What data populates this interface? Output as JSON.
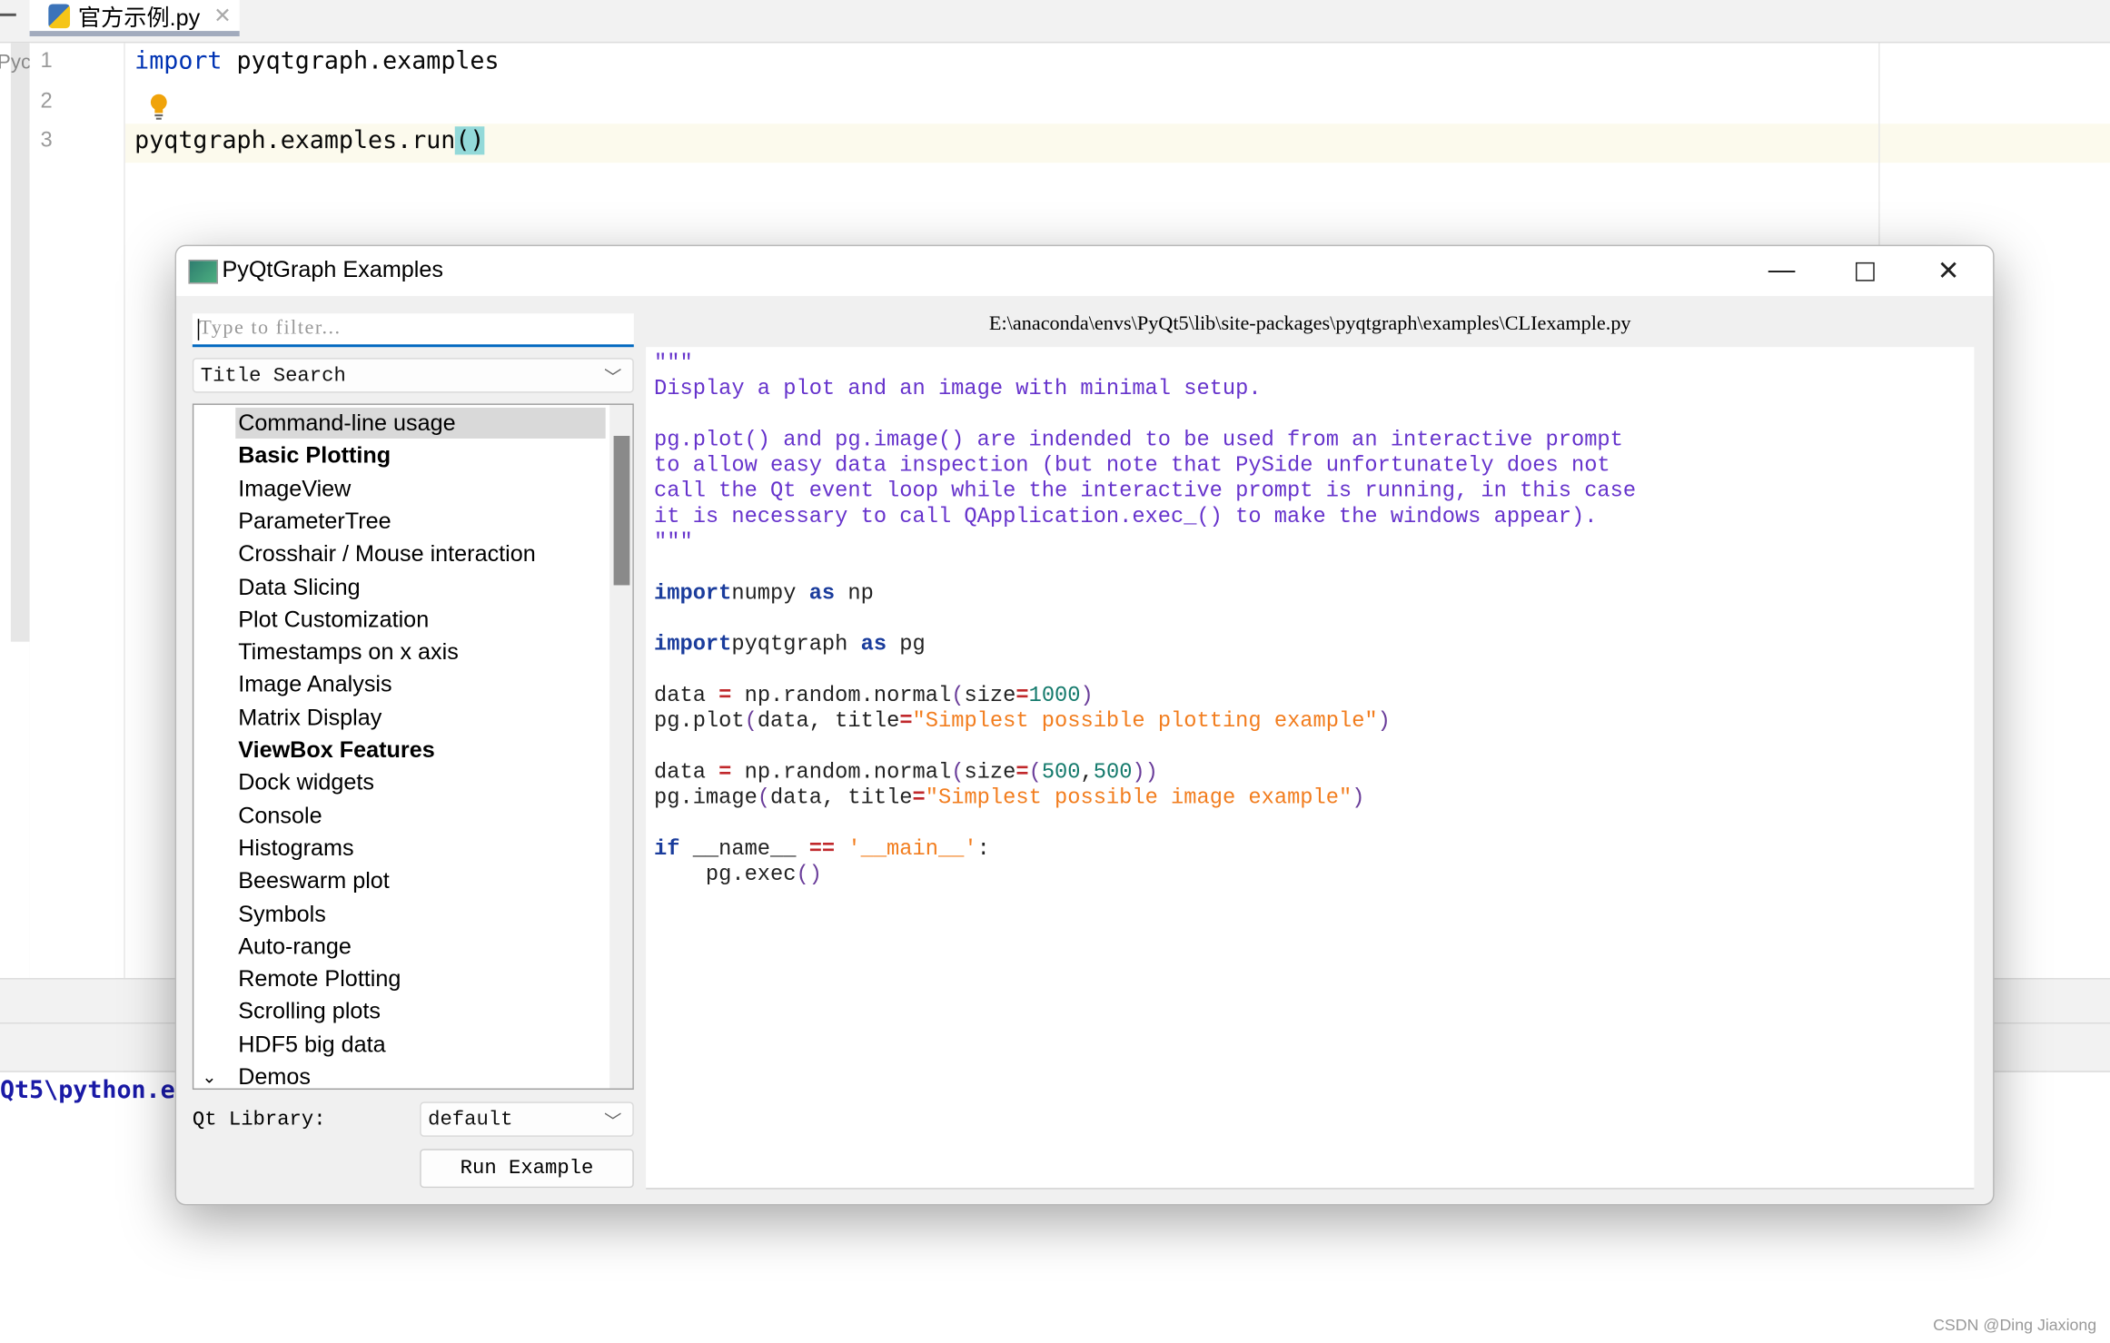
{
  "ide": {
    "tab_label": "官方示例.py",
    "left_panel_text": "Pyc",
    "line_numbers": [
      "1",
      "2",
      "3"
    ],
    "code_line1_kw": "import",
    "code_line1_rest": " pyqtgraph.examples",
    "code_line3": "pyqtgraph.examples.run",
    "code_line3_paren": "()",
    "terminal_text": "Qt5\\python.e",
    "watermark": "CSDN @Ding Jiaxiong"
  },
  "window": {
    "title": "PyQtGraph Examples",
    "filter_placeholder": "Type to filter...",
    "search_mode": "Title Search",
    "examples": [
      {
        "label": "Command-line usage",
        "selected": true,
        "bold": false
      },
      {
        "label": "Basic Plotting",
        "bold": true
      },
      {
        "label": "ImageView"
      },
      {
        "label": "ParameterTree"
      },
      {
        "label": "Crosshair / Mouse interaction"
      },
      {
        "label": "Data Slicing"
      },
      {
        "label": "Plot Customization"
      },
      {
        "label": "Timestamps on x axis"
      },
      {
        "label": "Image Analysis"
      },
      {
        "label": "Matrix Display"
      },
      {
        "label": "ViewBox Features",
        "bold": true
      },
      {
        "label": "Dock widgets"
      },
      {
        "label": "Console"
      },
      {
        "label": "Histograms"
      },
      {
        "label": "Beeswarm plot"
      },
      {
        "label": "Symbols"
      },
      {
        "label": "Auto-range"
      },
      {
        "label": "Remote Plotting"
      },
      {
        "label": "Scrolling plots"
      },
      {
        "label": "HDF5 big data"
      },
      {
        "label": "Demos",
        "expanded": true
      }
    ],
    "qt_library_label": "Qt Library:",
    "qt_library_value": "default",
    "run_button": "Run Example",
    "file_path": "E:\\anaconda\\envs\\PyQt5\\lib\\site-packages\\pyqtgraph\\examples\\CLIexample.py",
    "code_lines": [
      [
        [
          "doc",
          "\"\"\""
        ]
      ],
      [
        [
          "doc",
          "Display a plot and an image with minimal setup."
        ]
      ],
      [],
      [
        [
          "doc",
          "pg.plot() and pg.image() are indended to be used from an interactive prompt"
        ]
      ],
      [
        [
          "doc",
          "to allow easy data inspection (but note that PySide unfortunately does not"
        ]
      ],
      [
        [
          "doc",
          "call the Qt event loop while the interactive prompt is running, in this case"
        ]
      ],
      [
        [
          "doc",
          "it is necessary to call QApplication.exec_() to make the windows appear)."
        ]
      ],
      [
        [
          "doc",
          "\"\"\""
        ]
      ],
      [],
      [
        [
          "kw",
          "import"
        ],
        [
          "",
          "numpy "
        ],
        [
          "kw",
          "as"
        ],
        [
          "",
          " np"
        ]
      ],
      [],
      [
        [
          "kw",
          "import"
        ],
        [
          "",
          "pyqtgraph "
        ],
        [
          "kw",
          "as"
        ],
        [
          "",
          " pg"
        ]
      ],
      [],
      [
        [
          "",
          "data "
        ],
        [
          "op",
          "="
        ],
        [
          "",
          " np.random.normal"
        ],
        [
          "br",
          "("
        ],
        [
          "",
          "size"
        ],
        [
          "op",
          "="
        ],
        [
          "num",
          "1000"
        ],
        [
          "br",
          ")"
        ]
      ],
      [
        [
          "",
          "pg.plot"
        ],
        [
          "br",
          "("
        ],
        [
          "",
          "data, title"
        ],
        [
          "op",
          "="
        ],
        [
          "str",
          "\"Simplest possible plotting example\""
        ],
        [
          "br",
          ")"
        ]
      ],
      [],
      [
        [
          "",
          "data "
        ],
        [
          "op",
          "="
        ],
        [
          "",
          " np.random.normal"
        ],
        [
          "br",
          "("
        ],
        [
          "",
          "size"
        ],
        [
          "op",
          "="
        ],
        [
          "br",
          "("
        ],
        [
          "num",
          "500"
        ],
        [
          "",
          ","
        ],
        [
          "num",
          "500"
        ],
        [
          "br",
          "))"
        ]
      ],
      [
        [
          "",
          "pg.image"
        ],
        [
          "br",
          "("
        ],
        [
          "",
          "data, title"
        ],
        [
          "op",
          "="
        ],
        [
          "str",
          "\"Simplest possible image example\""
        ],
        [
          "br",
          ")"
        ]
      ],
      [],
      [
        [
          "kw",
          "if"
        ],
        [
          "",
          " __name__ "
        ],
        [
          "op",
          "=="
        ],
        [
          "str",
          " '__main__'"
        ],
        [
          "",
          ":"
        ]
      ],
      [
        [
          "",
          "    pg.exec"
        ],
        [
          "br",
          "()"
        ]
      ]
    ]
  }
}
